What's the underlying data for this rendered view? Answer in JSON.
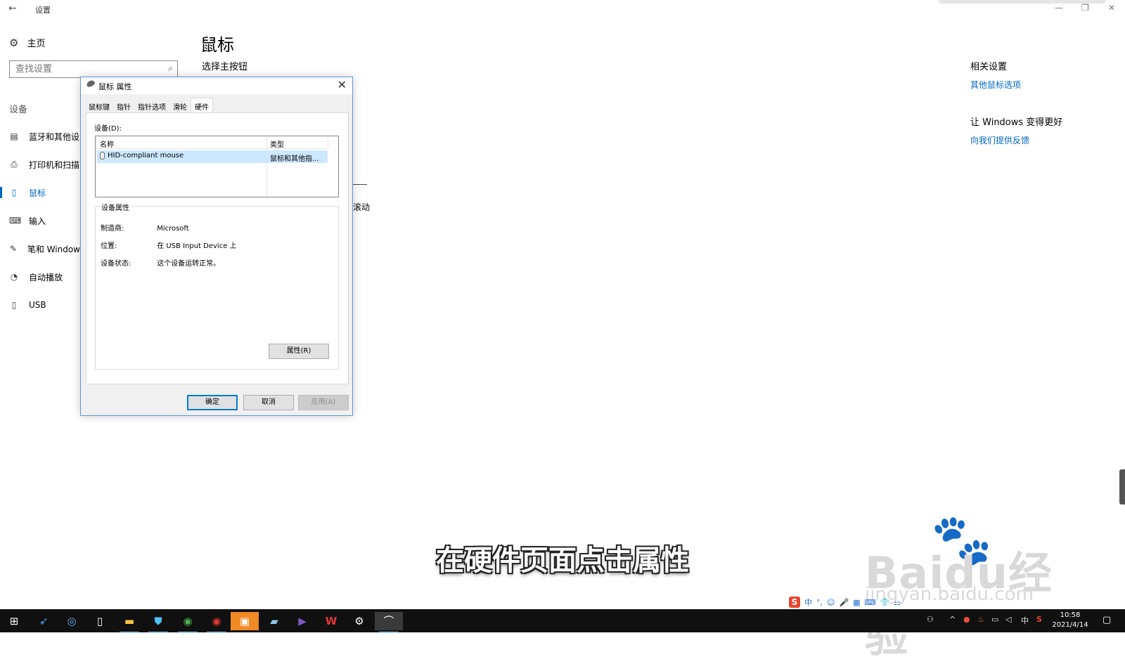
{
  "window": {
    "title": "设置",
    "back_icon": "arrow-left-icon",
    "controls": [
      "minimize",
      "restore",
      "close"
    ]
  },
  "sidebar": {
    "home_label": "主页",
    "search_placeholder": "查找设置",
    "section": "设备",
    "items": [
      {
        "label": "蓝牙和其他设",
        "icon": "bluetooth-device-icon"
      },
      {
        "label": "打印机和扫描",
        "icon": "printer-icon"
      },
      {
        "label": "鼠标",
        "icon": "mouse-icon",
        "active": true
      },
      {
        "label": "输入",
        "icon": "keyboard-icon"
      },
      {
        "label": "笔和 Window",
        "icon": "pen-icon"
      },
      {
        "label": "自动播放",
        "icon": "autoplay-icon"
      },
      {
        "label": "USB",
        "icon": "usb-icon"
      }
    ]
  },
  "main": {
    "title": "鼠标",
    "subheading": "选择主按钮",
    "partial_text": "滚动"
  },
  "related": {
    "heading": "相关设置",
    "link": "其他鼠标选项"
  },
  "better": {
    "heading": "让 Windows 变得更好",
    "link": "向我们提供反馈"
  },
  "dialog": {
    "title": "鼠标 属性",
    "tabs": [
      "鼠标键",
      "指针",
      "指针选项",
      "滑轮",
      "硬件"
    ],
    "selected_tab": "硬件",
    "devices_label": "设备(D):",
    "columns": [
      "名称",
      "类型"
    ],
    "devices": [
      {
        "name": "HID-compliant mouse",
        "type": "鼠标和其他指..."
      }
    ],
    "props_legend": "设备属性",
    "props": [
      {
        "key": "制造商:",
        "value": "Microsoft"
      },
      {
        "key": "位置:",
        "value": "在 USB Input Device 上"
      },
      {
        "key": "设备状态:",
        "value": "这个设备运转正常。"
      }
    ],
    "properties_button": "属性(R)",
    "ok": "确定",
    "cancel": "取消",
    "apply": "应用(A)"
  },
  "overlay": {
    "caption": "在硬件页面点击属性",
    "watermark_main": "Baidu经验",
    "watermark_url": "jingyan.baidu.com"
  },
  "ime": {
    "logo": "S",
    "mode": "中",
    "items": [
      "°,",
      "☺",
      "🎤",
      "▦",
      "⌨",
      "👕",
      "⚏"
    ]
  },
  "taskbar": {
    "apps": [
      "windows-start-icon",
      "feather-app-icon",
      "browser-s-icon",
      "file-icon",
      "file-explorer-icon",
      "security-shield-icon",
      "chrome-icon",
      "chrome-profile-icon",
      "orange-app-icon",
      "notes-app-icon",
      "media-player-icon",
      "wps-icon",
      "settings-gear-icon",
      "mouse-properties-icon"
    ],
    "tray_lang": "中",
    "time": "10:58",
    "date": "2021/4/14"
  }
}
